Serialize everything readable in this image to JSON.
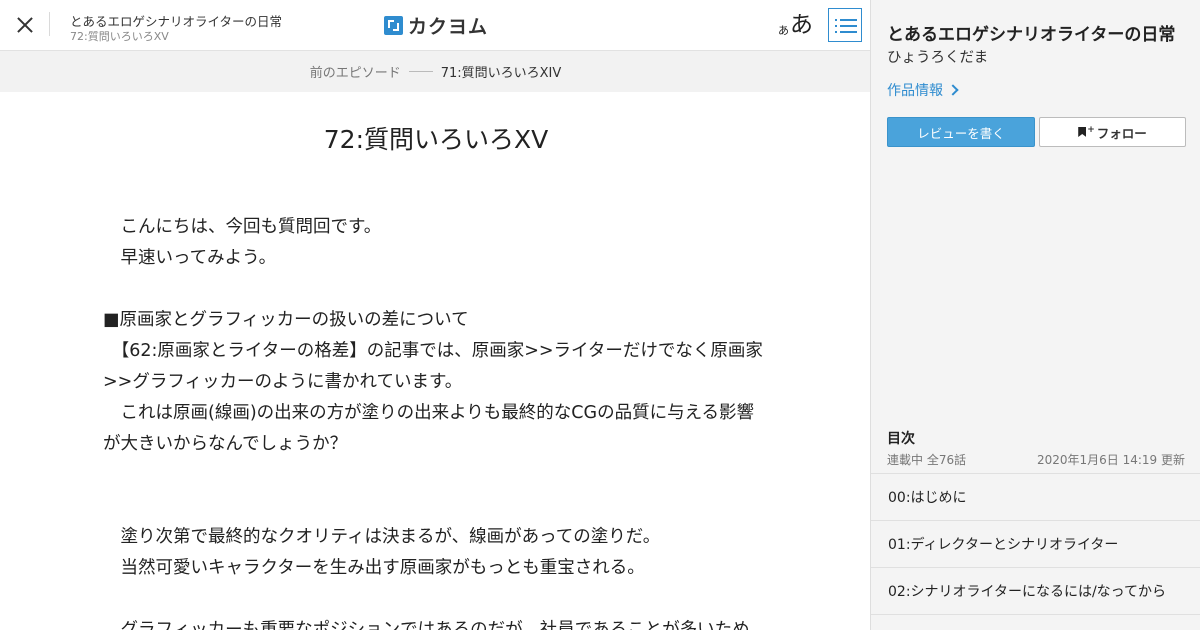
{
  "header": {
    "work_title": "とあるエロゲシナリオライターの日常",
    "episode_subtitle": "72:質問いろいろXV",
    "logo_text": "カクヨム",
    "font_size_small": "あ",
    "font_size_large": "あ",
    "close_icon": "close-icon",
    "toc_icon": "list-icon"
  },
  "episode_nav": {
    "prev_label": "前のエピソード",
    "prev_title": "71:質問いろいろXIV"
  },
  "episode": {
    "title": "72:質問いろいろXV",
    "paragraphs": [
      "　こんにちは、今回も質問回です。",
      "　早速いってみよう。",
      "",
      "■原画家とグラフィッカーの扱いの差について",
      "　【62:原画家とライターの格差】の記事では、原画家>>ライターだけでなく原画家>>グラフィッカーのように書かれています。",
      "　これは原画(線画)の出来の方が塗りの出来よりも最終的なCGの品質に与える影響が大きいからなんでしょうか？",
      "",
      "",
      "　塗り次第で最終的なクオリティは決まるが、線画があっての塗りだ。",
      "　当然可愛いキャラクターを生み出す原画家がもっとも重宝される。",
      "",
      "　グラフィッカーも重要なポジションではあるのだが、社員であることが多いため"
    ]
  },
  "side": {
    "title": "とあるエロゲシナリオライターの日常",
    "author": "ひょうろくだま",
    "work_info_label": "作品情報",
    "review_button": "レビューを書く",
    "follow_button": "フォロー",
    "toc_heading": "目次",
    "toc_status": "連載中 全76話",
    "toc_updated": "2020年1月6日 14:19 更新",
    "toc_items": [
      "00:はじめに",
      "01:ディレクターとシナリオライター",
      "02:シナリオライターになるには/なってから"
    ]
  },
  "colors": {
    "accent": "#2f8ccf",
    "button_blue": "#4aa3db",
    "nav_bg": "#f2f2f2",
    "side_bg": "#f4f4f4"
  }
}
